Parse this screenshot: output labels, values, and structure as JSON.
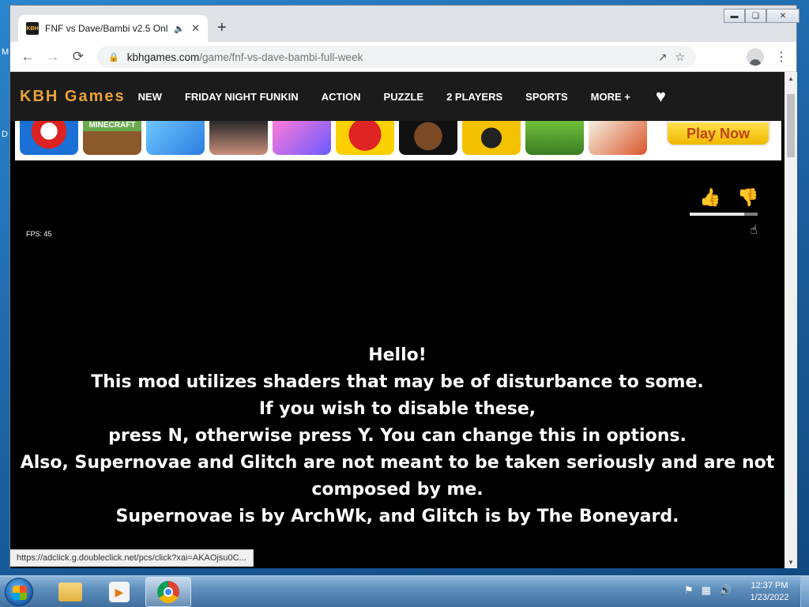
{
  "browser": {
    "tab_title": "FNF vs Dave/Bambi v2.5 Onl",
    "favicon_text": "KBH",
    "address_host": "kbhgames.com",
    "address_path": "/game/fnf-vs-dave-bambi-full-week",
    "status_url": "https://adclick.g.doubleclick.net/pcs/click?xai=AKAOjsu0C..."
  },
  "site": {
    "logo": "KBH Games",
    "nav": [
      "NEW",
      "FRIDAY NIGHT FUNKIN",
      "ACTION",
      "PUZZLE",
      "2 PLAYERS",
      "SPORTS",
      "MORE +"
    ],
    "play_now": "Play Now",
    "thumbnail_labels": [
      "MINECRAFT"
    ]
  },
  "game": {
    "fps_label": "FPS: 45",
    "message_lines": [
      "Hello!",
      "This mod utilizes shaders that may be of disturbance to some.",
      "If you wish to disable these,",
      "press N, otherwise press Y. You can change this in options.",
      "Also, Supernovae and Glitch are not meant to be taken seriously and are not",
      "composed by me.",
      "Supernovae is by ArchWk, and Glitch is by The Boneyard."
    ],
    "rating_fraction": 0.8
  },
  "desktop": {
    "side_letters": [
      "M",
      "D"
    ]
  },
  "taskbar": {
    "time": "12:37 PM",
    "date": "1/23/2022"
  },
  "colors": {
    "logo": "#e9a23b",
    "nav_bg": "#1b1b1b",
    "play_now_text": "#c2410c"
  }
}
